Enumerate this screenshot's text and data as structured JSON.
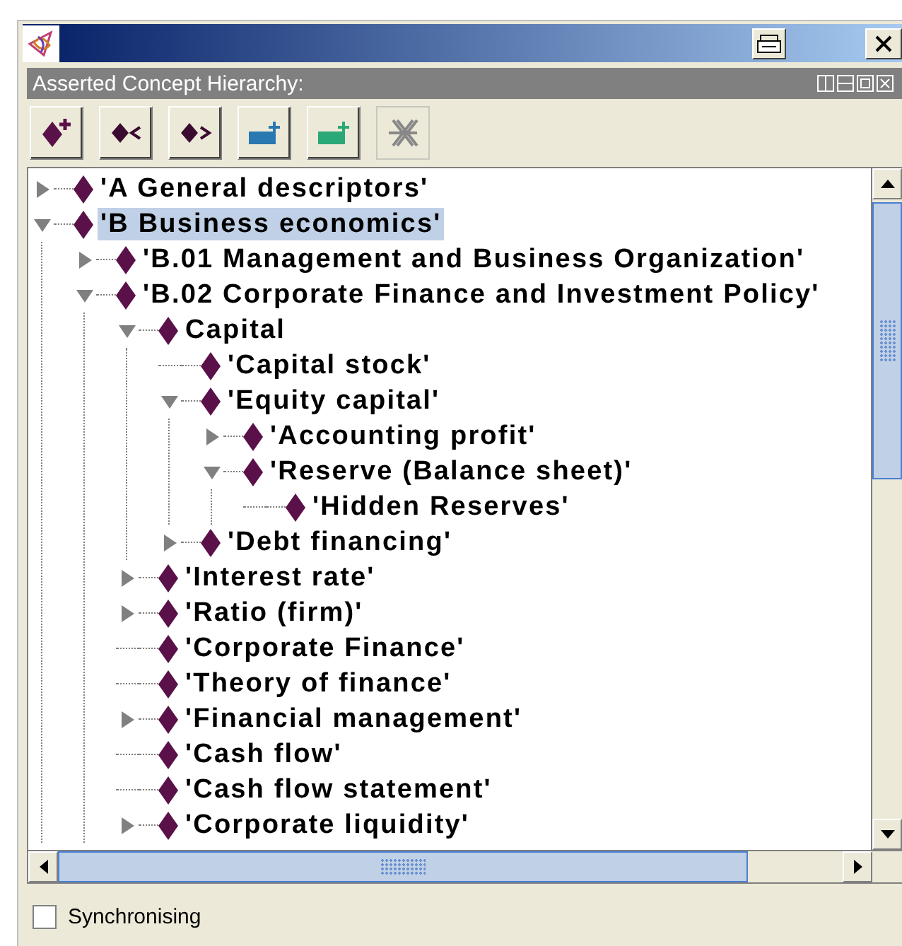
{
  "panel": {
    "title": "Asserted Concept Hierarchy:"
  },
  "toolbar": [
    {
      "disabled": false
    },
    {
      "disabled": false
    },
    {
      "disabled": false
    },
    {
      "disabled": false
    },
    {
      "disabled": false
    },
    {
      "disabled": true
    }
  ],
  "tree": [
    {
      "label": "'A General descriptors'",
      "kind": "branch",
      "expanded": false,
      "selected": false
    },
    {
      "label": "'B Business economics'",
      "kind": "branch",
      "expanded": true,
      "selected": true,
      "children": [
        {
          "label": "'B.01 Management and Business Organization'",
          "kind": "branch",
          "expanded": false,
          "selected": false
        },
        {
          "label": "'B.02 Corporate Finance and Investment Policy'",
          "kind": "branch",
          "expanded": true,
          "selected": false,
          "children": [
            {
              "label": "Capital",
              "kind": "branch",
              "expanded": true,
              "selected": false,
              "children": [
                {
                  "label": "'Capital stock'",
                  "kind": "leaf",
                  "selected": false
                },
                {
                  "label": "'Equity capital'",
                  "kind": "branch",
                  "expanded": true,
                  "selected": false,
                  "children": [
                    {
                      "label": "'Accounting profit'",
                      "kind": "branch",
                      "expanded": false,
                      "selected": false
                    },
                    {
                      "label": "'Reserve (Balance sheet)'",
                      "kind": "branch",
                      "expanded": true,
                      "selected": false,
                      "children": [
                        {
                          "label": "'Hidden Reserves'",
                          "kind": "leaf",
                          "selected": false
                        }
                      ]
                    }
                  ]
                },
                {
                  "label": "'Debt financing'",
                  "kind": "branch",
                  "expanded": false,
                  "selected": false
                }
              ]
            },
            {
              "label": "'Interest rate'",
              "kind": "branch",
              "expanded": false,
              "selected": false
            },
            {
              "label": "'Ratio (firm)'",
              "kind": "branch",
              "expanded": false,
              "selected": false
            },
            {
              "label": "'Corporate Finance'",
              "kind": "leaf",
              "selected": false
            },
            {
              "label": "'Theory of finance'",
              "kind": "leaf",
              "selected": false
            },
            {
              "label": "'Financial management'",
              "kind": "branch",
              "expanded": false,
              "selected": false
            },
            {
              "label": "'Cash flow'",
              "kind": "leaf",
              "selected": false
            },
            {
              "label": "'Cash flow statement'",
              "kind": "leaf",
              "selected": false
            },
            {
              "label": "'Corporate liquidity'",
              "kind": "branch",
              "expanded": false,
              "selected": false
            }
          ]
        }
      ]
    }
  ],
  "footer": {
    "synchronising": {
      "label": "Synchronising",
      "checked": false
    }
  }
}
